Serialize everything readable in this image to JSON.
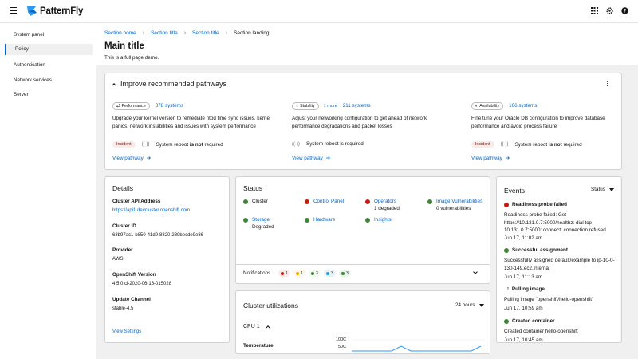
{
  "masthead": {
    "brand": "PatternFly",
    "icons": [
      "apps-grid-icon",
      "settings-gear-icon",
      "help-icon"
    ]
  },
  "sidebar": {
    "items": [
      {
        "label": "System panel"
      },
      {
        "label": "Policy"
      },
      {
        "label": "Authentication"
      },
      {
        "label": "Network services"
      },
      {
        "label": "Server"
      }
    ],
    "active_index": 1
  },
  "breadcrumb": {
    "items": [
      "Section home",
      "Section title",
      "Section title",
      "Section landing"
    ]
  },
  "page": {
    "title": "Main title",
    "subtitle": "This is a full page demo."
  },
  "pathways": {
    "title": "Improve recommended pathways",
    "cols": [
      {
        "tag": "Performance",
        "more": "",
        "count": "378 systems",
        "desc": "Upgrade your kernel version to remediate ntpd time sync issues, kernel panics, network instabilities and issues with system performance",
        "incident": "Incident",
        "reboot_pre": "System reboot ",
        "reboot_bold": "is not",
        "reboot_post": " required",
        "link": "View pathway"
      },
      {
        "tag": "Stability",
        "more": "1 more",
        "count": "211 systems",
        "desc": "Adjust your networking configuration to get ahead of network performance degradations and packet losses",
        "incident": "",
        "reboot_pre": "System reboot ",
        "reboot_bold": "is",
        "reboot_post": " required",
        "link": "View pathway"
      },
      {
        "tag": "Availability",
        "more": "",
        "count": "166 systems",
        "desc": "Fine tune your Oracle DB configuration to improve database performance and avoid process failure",
        "incident": "Incident",
        "reboot_pre": "System reboot ",
        "reboot_bold": "is not",
        "reboot_post": " required",
        "link": "View pathway"
      }
    ]
  },
  "details": {
    "title": "Details",
    "fields": [
      {
        "label": "Cluster API Address",
        "value": "https://api1.devcluster.openshift.com",
        "link": true
      },
      {
        "label": "Cluster ID",
        "value": "63b97ac1-b850-41d9-8820-239becde9e86",
        "link": false
      },
      {
        "label": "Provider",
        "value": "AWS",
        "link": false
      },
      {
        "label": "OpenShift Version",
        "value": "4.5.0.ci-2020-06-16-015028",
        "link": false
      },
      {
        "label": "Update Channel",
        "value": "stable-4.5",
        "link": false
      }
    ],
    "settings_link": "View Settings"
  },
  "status": {
    "title": "Status",
    "items": [
      {
        "label": "Cluster",
        "sub": "",
        "state": "ok",
        "link": false
      },
      {
        "label": "Control Panel",
        "sub": "",
        "state": "err",
        "link": true
      },
      {
        "label": "Operators",
        "sub": "1 degraded",
        "state": "err",
        "link": true
      },
      {
        "label": "Image Vulnerabilities",
        "sub": "0 vulnerabilities",
        "state": "ok",
        "link": true
      },
      {
        "label": "Storage",
        "sub": "Degraded",
        "state": "ok",
        "link": true
      },
      {
        "label": "Hardware",
        "sub": "",
        "state": "ok",
        "link": true
      },
      {
        "label": "Insights",
        "sub": "",
        "state": "ok",
        "link": true
      }
    ],
    "notifications": {
      "label": "Notifications",
      "badges": [
        {
          "kind": "critical",
          "count": "1",
          "bg": "#faeae8",
          "fg": "#c9190b"
        },
        {
          "kind": "warning",
          "count": "1",
          "bg": "#fdf7e7",
          "fg": "#f0ab00"
        },
        {
          "kind": "success",
          "count": "3",
          "bg": "#f3faf2",
          "fg": "#3e8635"
        },
        {
          "kind": "info",
          "count": "3",
          "bg": "#e7f1fa",
          "fg": "#2b9af3"
        },
        {
          "kind": "default",
          "count": "3",
          "bg": "#e8f5ec",
          "fg": "#3e8635"
        }
      ]
    }
  },
  "utilization": {
    "title": "Cluster utilizations",
    "range": "24 hours",
    "metric": "CPU 1",
    "temp_label": "Temperature",
    "ticks": [
      "100C",
      "50C"
    ]
  },
  "events": {
    "title": "Events",
    "filter": "Status",
    "items": [
      {
        "state": "err",
        "title": "Readiness probe failed",
        "text": "Readiness probe failed: Get https://10.131.0.7:5000/healthz: dial tcp 10.131.0.7:5000: connect: connection refused",
        "time": "Jun 17, 11:02 am"
      },
      {
        "state": "ok",
        "title": "Successful assignment",
        "text": "Successfully assigned default/example to ip-10-0-130-149.ec2.internal",
        "time": "Jun 17, 11:13 am"
      },
      {
        "state": "pending",
        "title": "Pulling image",
        "text": "Pulling image \"openshift/hello-openshift\"",
        "time": "Jun 17, 10:59 am"
      },
      {
        "state": "ok",
        "title": "Created container",
        "text": "Created container hello-openshift",
        "time": "Jun 17, 10:45 am"
      }
    ]
  },
  "colors": {
    "link": "#0066cc",
    "success": "#3e8635",
    "danger": "#c9190b",
    "brand": "#2b9af3"
  }
}
